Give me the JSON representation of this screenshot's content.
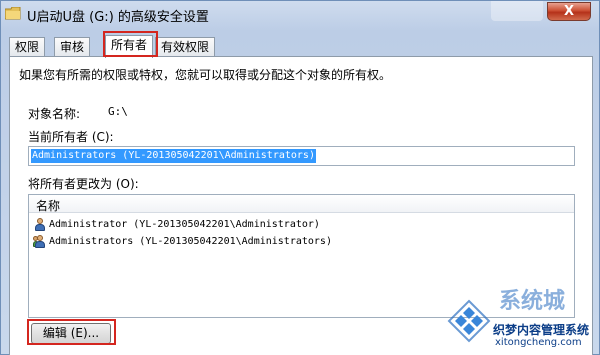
{
  "window": {
    "title": "U启动U盘 (G:) 的高级安全设置",
    "close_label": "X"
  },
  "tabs": [
    {
      "label": "权限",
      "active": false
    },
    {
      "label": "审核",
      "active": false
    },
    {
      "label": "所有者",
      "active": true
    },
    {
      "label": "有效权限",
      "active": false
    }
  ],
  "owner_tab": {
    "description": "如果您有所需的权限或特权，您就可以取得或分配这个对象的所有权。",
    "object_name_label": "对象名称:",
    "object_name_value": "G:\\",
    "current_owner_label": "当前所有者 (C):",
    "current_owner_value": "Administrators (YL-201305042201\\Administrators)",
    "change_owner_label": "将所有者更改为 (O):",
    "list_header": "名称",
    "list_items": [
      {
        "name": "Administrator (YL-201305042201\\Administrator)",
        "icon": "user-icon"
      },
      {
        "name": "Administrators (YL-201305042201\\Administrators)",
        "icon": "group-icon"
      }
    ],
    "edit_button": "编辑 (E)..."
  },
  "watermark": {
    "brand": "系统城",
    "text": "织梦内容管理系统",
    "url": "xitongcheng.com"
  },
  "colors": {
    "highlight_box": "#d4261f",
    "selection": "#3399ff",
    "accent": "#2c6fc0"
  }
}
